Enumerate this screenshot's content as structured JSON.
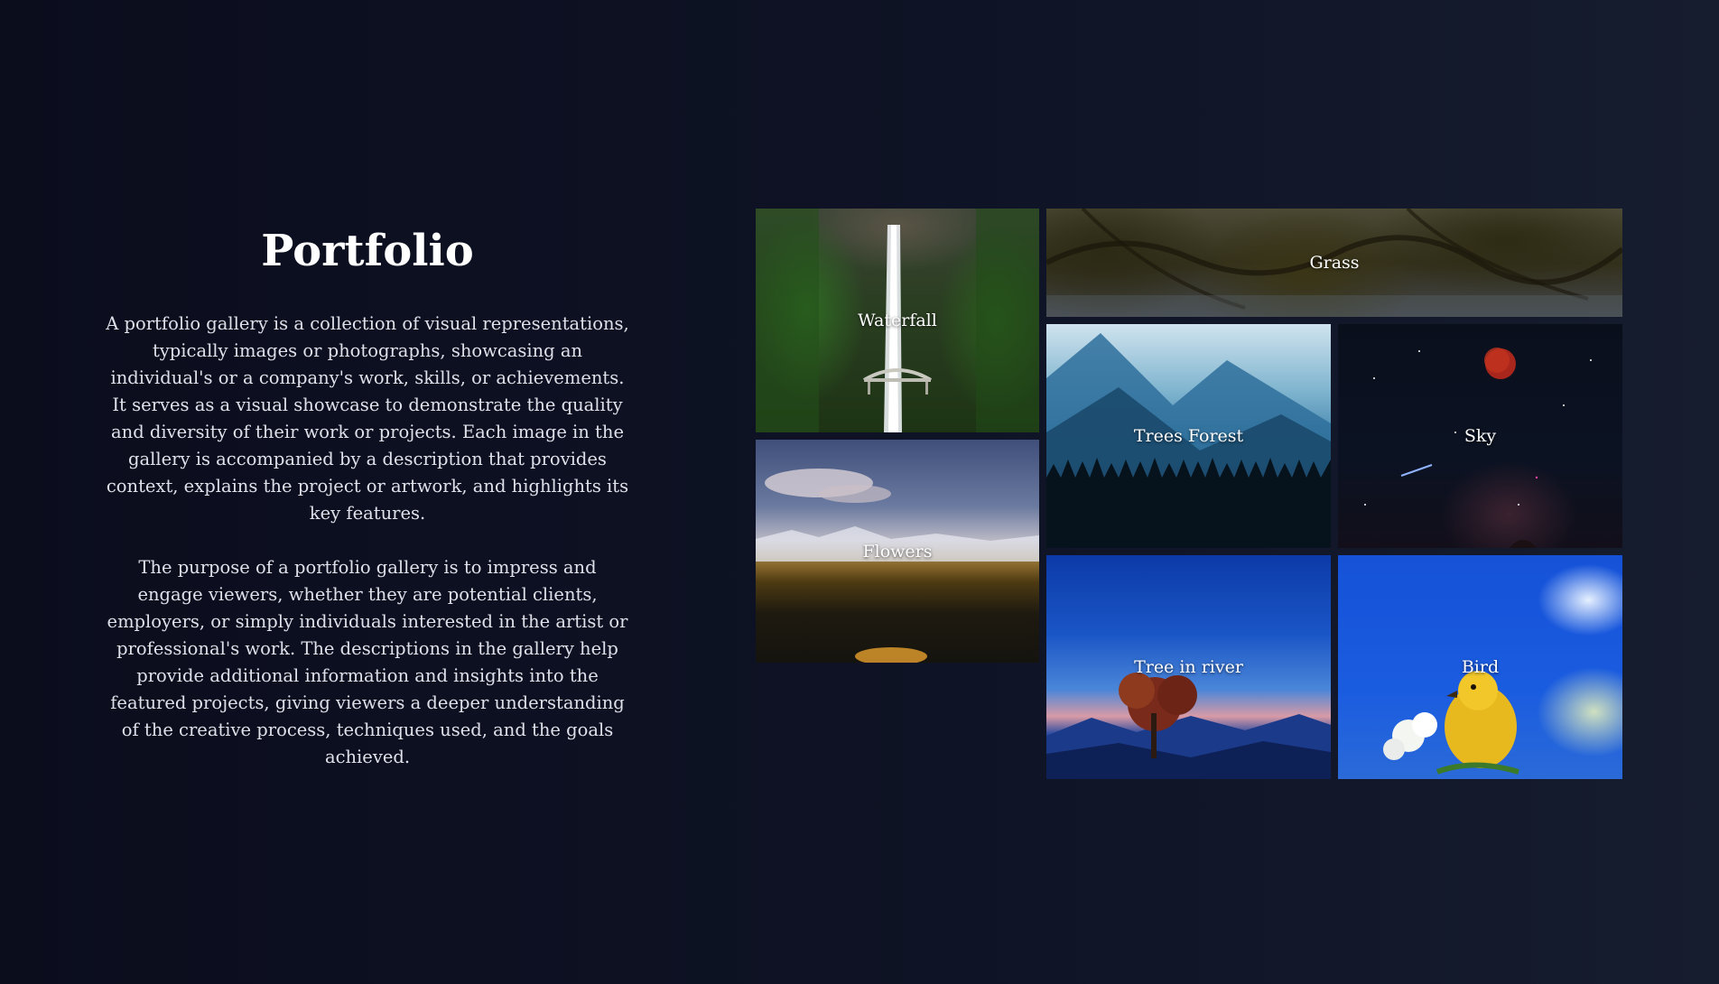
{
  "intro": {
    "title": "Portfolio",
    "paragraph_1": "A portfolio gallery is a collection of visual representations, typically images or photographs, showcasing an individual's or a company's work, skills, or achievements. It serves as a visual showcase to demonstrate the quality and diversity of their work or projects. Each image in the gallery is accompanied by a description that provides context, explains the project or artwork, and highlights its key features.",
    "paragraph_2": "The purpose of a portfolio gallery is to impress and engage viewers, whether they are potential clients, employers, or simply individuals interested in the artist or professional's work. The descriptions in the gallery help provide additional information and insights into the featured projects, giving viewers a deeper understanding of the creative process, techniques used, and the goals achieved."
  },
  "gallery": {
    "waterfall": {
      "label": "Waterfall"
    },
    "grass": {
      "label": "Grass"
    },
    "trees_forest": {
      "label": "Trees Forest"
    },
    "sky": {
      "label": "Sky"
    },
    "flowers": {
      "label": "Flowers"
    },
    "tree_in_river": {
      "label": "Tree in river"
    },
    "bird": {
      "label": "Bird"
    }
  },
  "colors": {
    "background": "#0e1325",
    "heading": "#ffffff",
    "body_text": "#dfe1ea"
  }
}
